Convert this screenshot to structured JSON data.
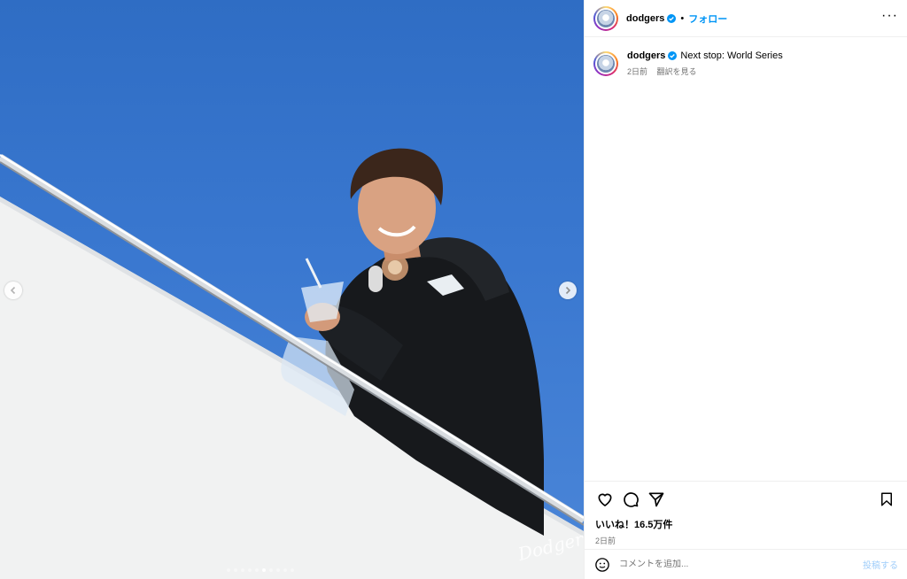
{
  "header": {
    "username": "dodgers",
    "separator": "•",
    "follow_label": "フォロー",
    "more_icon": "more-horizontal-icon"
  },
  "caption": {
    "username": "dodgers",
    "text": "Next stop: World Series",
    "time_ago": "2日前",
    "translate_label": "翻訳を見る"
  },
  "media": {
    "watermark": "Dodgers",
    "carousel_dots": 10,
    "active_dot": 5
  },
  "actions": {
    "likes": "いいね！16.5万件",
    "date": "2日前"
  },
  "comment": {
    "placeholder": "コメントを追加...",
    "post_label": "投稿する"
  },
  "colors": {
    "accent": "#0095f6",
    "verified": "#0095f6",
    "post_disabled": "#9fcdfa",
    "sky": "#3a78d0"
  }
}
